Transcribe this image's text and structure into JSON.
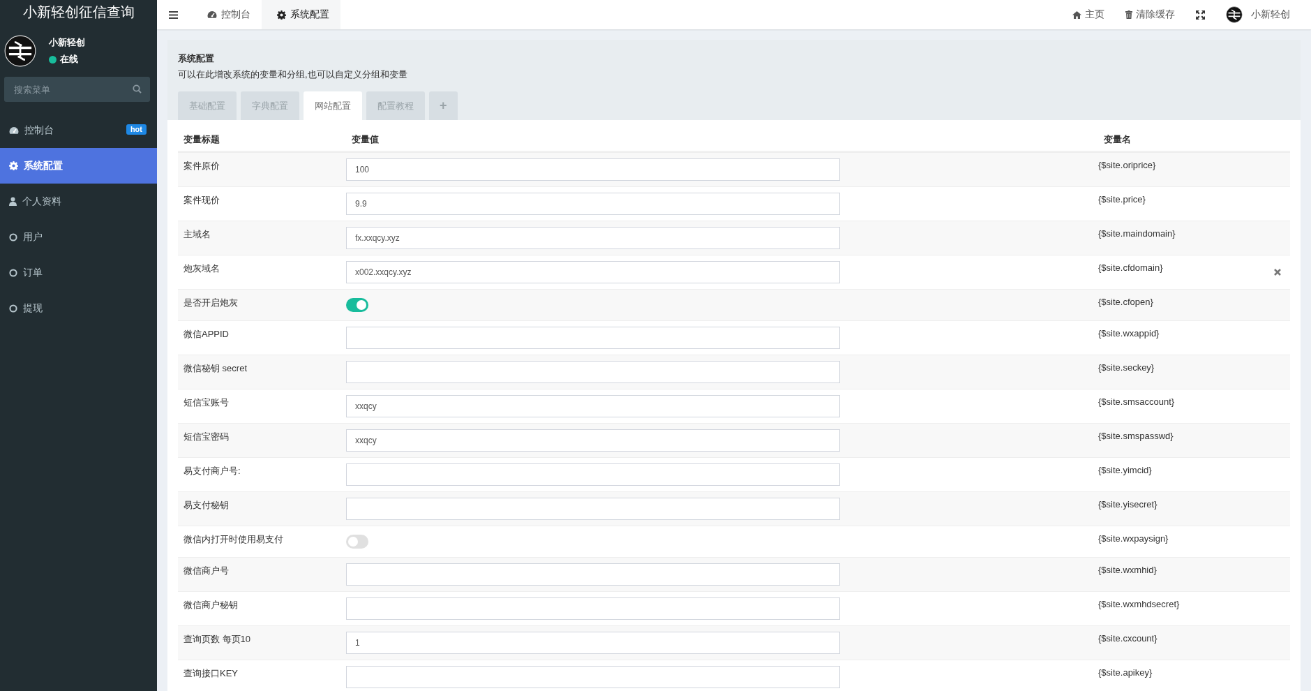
{
  "app": {
    "title": "小新轻创征信查询"
  },
  "user": {
    "name": "小新轻创",
    "status": "在线",
    "online": true
  },
  "search": {
    "placeholder": "搜索菜单"
  },
  "sidebar": {
    "items": [
      {
        "label": "控制台",
        "badge": "hot",
        "selected": false
      },
      {
        "label": "系统配置",
        "selected": true
      },
      {
        "label": "个人资料",
        "selected": false
      },
      {
        "label": "用户",
        "selected": false
      },
      {
        "label": "订单",
        "selected": false
      },
      {
        "label": "提现",
        "selected": false
      }
    ]
  },
  "topbar": {
    "tabs": [
      {
        "label": "控制台",
        "selected": false
      },
      {
        "label": "系统配置",
        "selected": true
      }
    ],
    "actions": [
      "主页",
      "清除缓存"
    ],
    "user_name": "小新轻创"
  },
  "panel": {
    "title": "系统配置",
    "description": "可以在此增改系统的变量和分组,也可以自定义分组和变量",
    "tabs": [
      {
        "label": "基础配置",
        "selected": false
      },
      {
        "label": "字典配置",
        "selected": false
      },
      {
        "label": "网站配置",
        "selected": true
      },
      {
        "label": "配置教程",
        "selected": false
      }
    ],
    "add_tab": "+"
  },
  "table": {
    "columns": [
      "变量标题",
      "变量值",
      "变量名"
    ],
    "rows": [
      {
        "kind": "text",
        "title": "案件原价",
        "value": "100",
        "varname": "{$site.oriprice}",
        "deletable": false
      },
      {
        "kind": "text",
        "title": "案件现价",
        "value": "9.9",
        "varname": "{$site.price}",
        "deletable": false
      },
      {
        "kind": "text",
        "title": "主域名",
        "value": "fx.xxqcy.xyz",
        "varname": "{$site.maindomain}",
        "deletable": false
      },
      {
        "kind": "text",
        "title": "炮灰域名",
        "value": "x002.xxqcy.xyz",
        "varname": "{$site.cfdomain}",
        "deletable": true
      },
      {
        "kind": "switch",
        "title": "是否开启炮灰",
        "on": true,
        "varname": "{$site.cfopen}",
        "deletable": false
      },
      {
        "kind": "text",
        "title": "微信APPID",
        "varname": "{$site.wxappid}",
        "deletable": false
      },
      {
        "kind": "text",
        "title": "微信秘钥 secret",
        "varname": "{$site.seckey}",
        "deletable": false
      },
      {
        "kind": "text",
        "title": "短信宝账号",
        "value": "xxqcy",
        "varname": "{$site.smsaccount}",
        "deletable": false
      },
      {
        "kind": "text",
        "title": "短信宝密码",
        "value": "xxqcy",
        "varname": "{$site.smspasswd}",
        "deletable": false
      },
      {
        "kind": "text",
        "title": "易支付商户号:",
        "varname": "{$site.yimcid}",
        "deletable": false
      },
      {
        "kind": "text",
        "title": "易支付秘钥",
        "varname": "{$site.yisecret}",
        "deletable": false
      },
      {
        "kind": "switch",
        "title": "微信内打开时使用易支付",
        "on": false,
        "varname": "{$site.wxpaysign}",
        "deletable": false
      },
      {
        "kind": "text",
        "title": "微信商户号",
        "varname": "{$site.wxmhid}",
        "deletable": false
      },
      {
        "kind": "text",
        "title": "微信商户秘钥",
        "varname": "{$site.wxmhdsecret}",
        "deletable": false
      },
      {
        "kind": "text",
        "title": "查询页数 每页10",
        "value": "1",
        "varname": "{$site.cxcount}",
        "deletable": false
      },
      {
        "kind": "text",
        "title": "查询接口KEY",
        "varname": "{$site.apikey}",
        "deletable": false
      }
    ]
  }
}
